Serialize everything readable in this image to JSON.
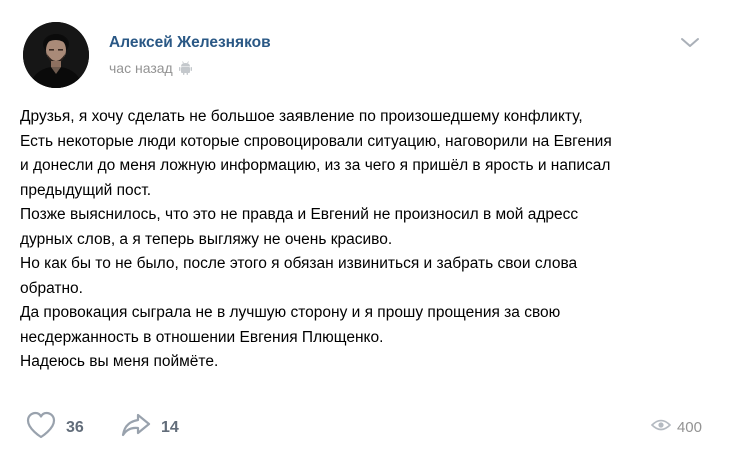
{
  "post": {
    "author": {
      "name": "Алексей Железняков"
    },
    "time": "час назад",
    "platform_icon": "android-icon",
    "menu_icon": "chevron-down-icon",
    "text_lines": [
      "Друзья, я хочу сделать не большое заявление по произошедшему конфликту,",
      "Есть некоторые люди которые спровоцировали ситуацию, наговорили на Евгения",
      "и донесли до меня ложную информацию, из за чего я пришёл в ярость и написал",
      "предыдущий пост.",
      "Позже выяснилось, что это не правда и Евгений не произносил в мой адресс",
      "дурных слов, а я теперь выгляжу не очень красиво.",
      "Но как бы то не было, после этого я обязан извиниться и забрать свои слова",
      "обратно.",
      "Да провокация сыграла не в лучшую сторону и я прошу прощения за свою",
      "несдержанность в отношении Евгения Плющенко.",
      "Надеюсь вы меня поймёте."
    ],
    "footer": {
      "likes": "36",
      "like_icon": "heart-icon",
      "shares": "14",
      "share_icon": "share-arrow-icon",
      "views": "400",
      "views_icon": "eye-icon"
    },
    "colors": {
      "author_name": "#2a5885",
      "meta_text": "#939393",
      "action_icon": "#99a2ad",
      "action_count": "#626d7a"
    }
  }
}
